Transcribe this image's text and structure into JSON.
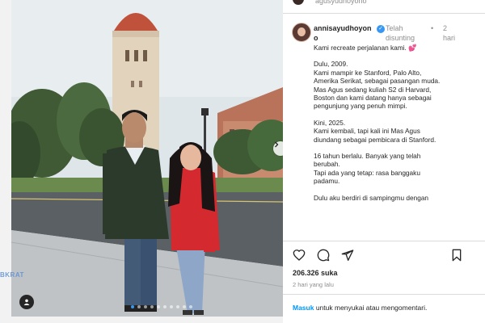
{
  "header": {
    "top_username": "agusyudhoyono"
  },
  "post": {
    "username_line1": "annisayudhoyon",
    "username_line2": "o",
    "pinned_line1": "Telah",
    "pinned_line2": "disunting",
    "time_dot": "•",
    "time_line1": "2",
    "time_line2": "hari",
    "caption_lines": [
      [
        "Kami recreate perjalanan kami. 💕"
      ],
      [
        "Dulu, 2009.",
        "Kami mampir ke Stanford, Palo Alto,",
        "Amerika Serikat, sebagai pasangan muda.",
        "Mas Agus sedang kuliah S2 di Harvard,",
        "Boston dan kami datang hanya sebagai",
        "pengunjung yang penuh mimpi."
      ],
      [
        "Kini, 2025.",
        "Kami kembali, tapi kali ini Mas Agus",
        "diundang sebagai pembicara di Stanford."
      ],
      [
        "16 tahun berlalu. Banyak yang telah",
        "berubah.",
        "Tapi ada yang tetap: rasa banggaku",
        "padamu."
      ],
      [
        "Dulu aku berdiri di sampingmu dengan"
      ]
    ],
    "likes": "206.326 suka",
    "posted_ago": "2 hari yang lalu",
    "login_link": "Masuk",
    "login_rest": " untuk menyukai atau mengomentari."
  },
  "photo": {
    "watermark": "BKRAT",
    "carousel_count": 10,
    "carousel_active": 0
  },
  "icons": {
    "like": "heart-icon",
    "comment": "comment-icon",
    "share": "share-icon",
    "save": "bookmark-icon",
    "next": "chevron-right-icon",
    "tag": "user-tag-icon",
    "verified": "verified-badge-icon"
  },
  "colors": {
    "link": "#0095f6",
    "verified": "#3897f0",
    "sweater": "#d42a2f",
    "tower": "#e2d3bd",
    "tower_roof": "#c0523c"
  }
}
